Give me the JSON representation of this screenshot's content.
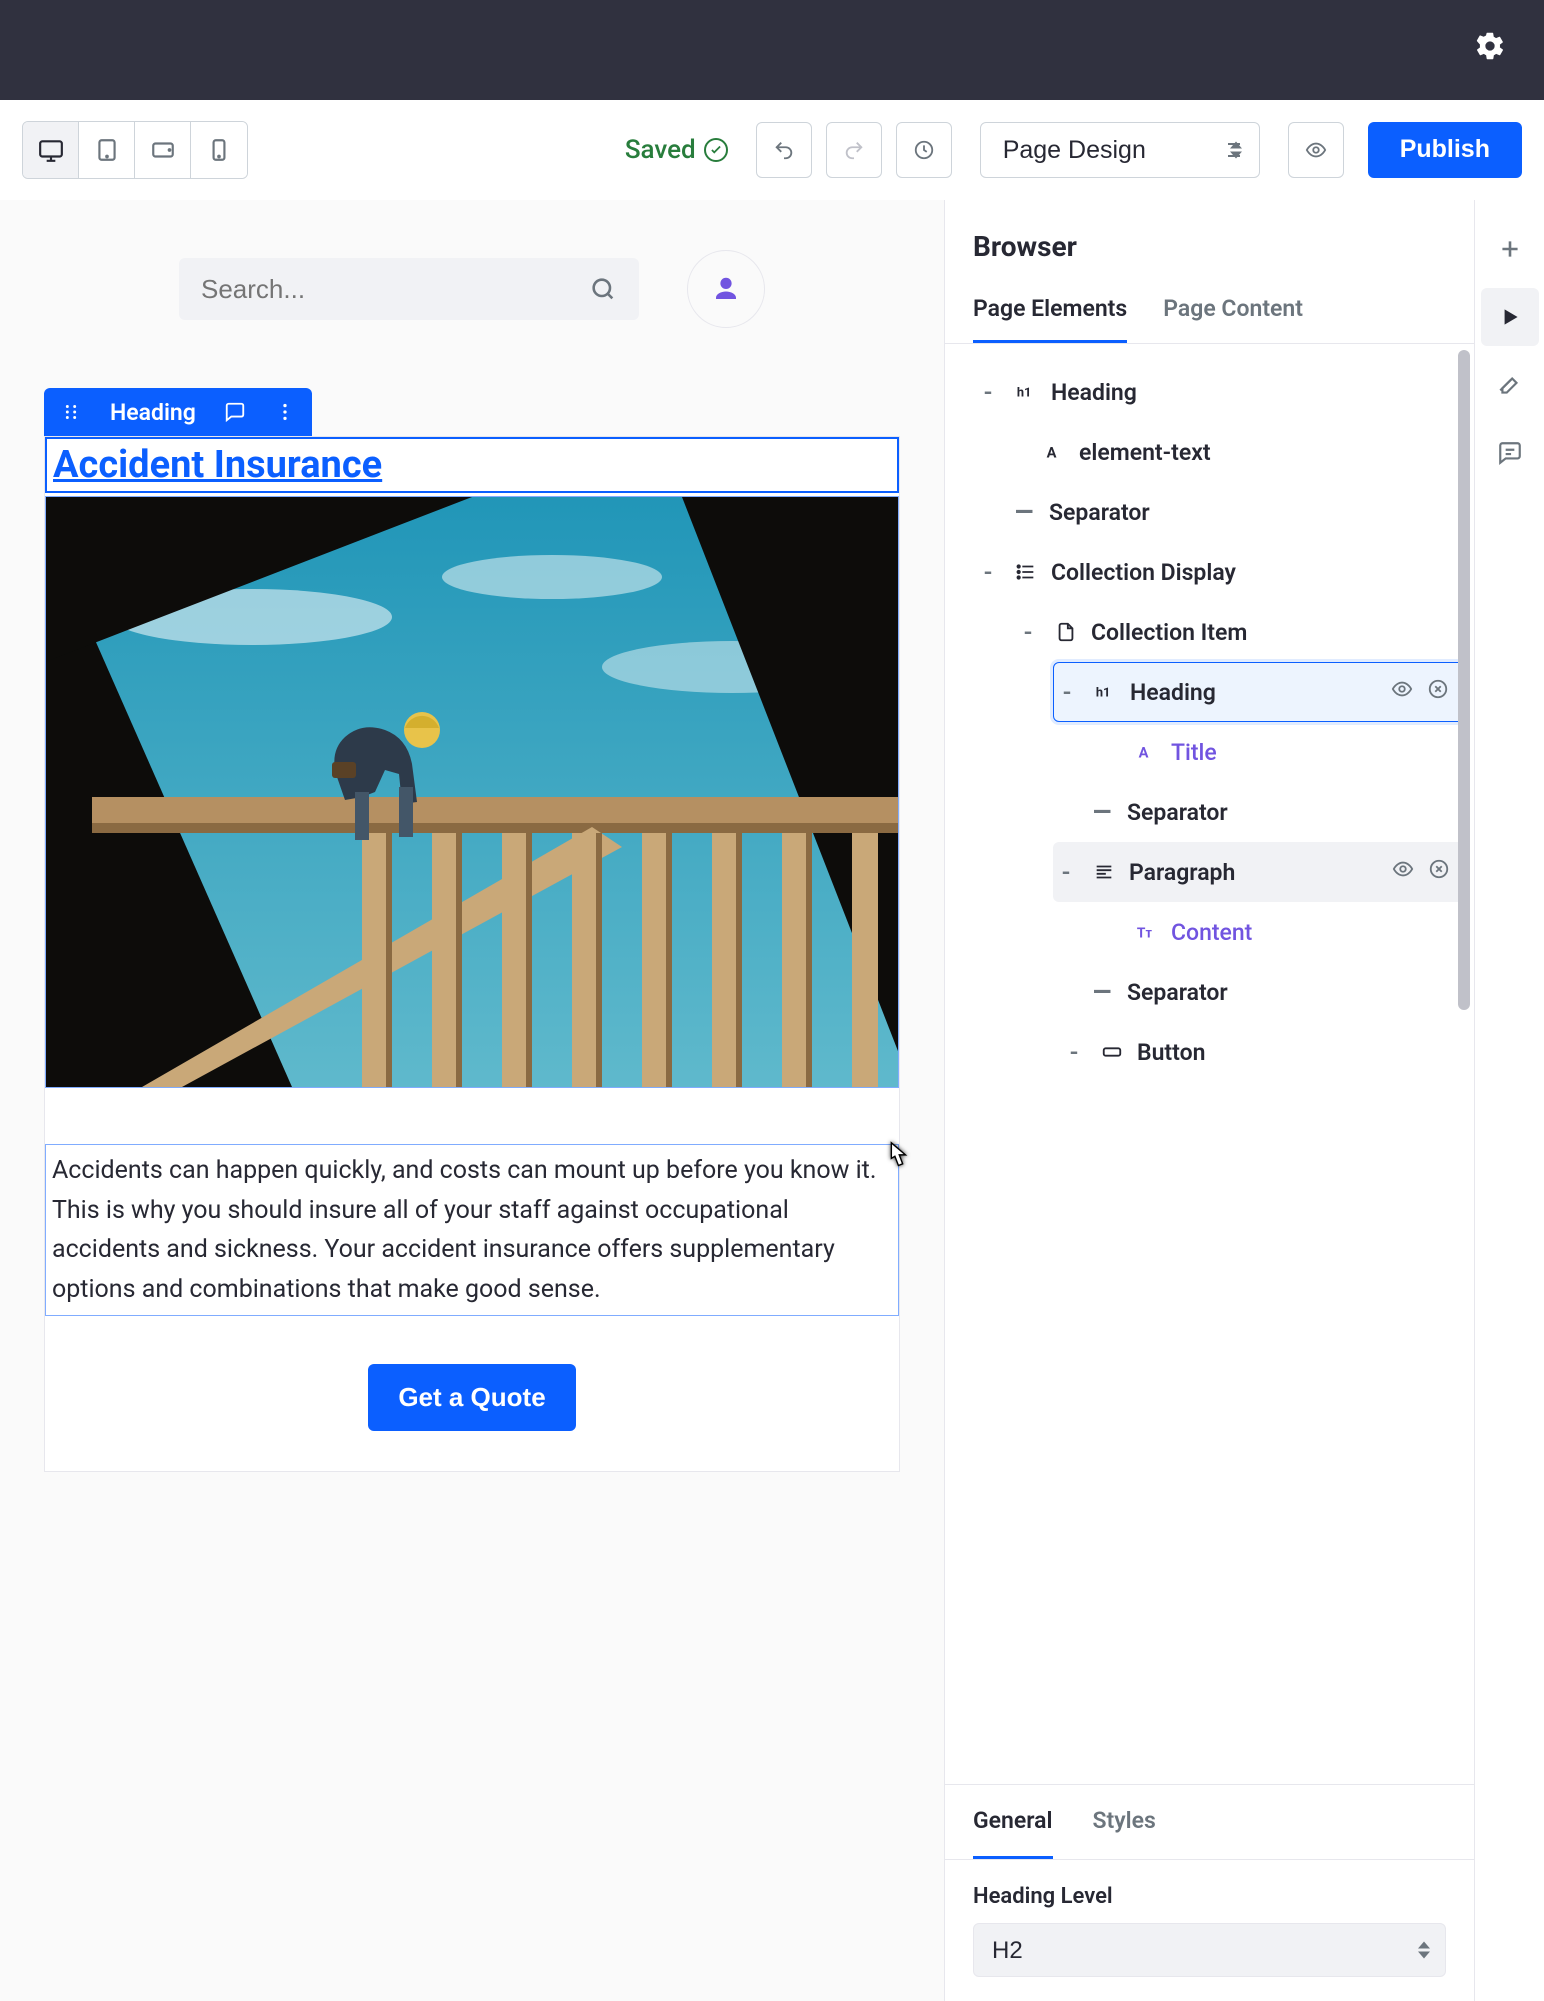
{
  "topbar": {
    "settings_icon": "gear"
  },
  "toolbar": {
    "saved_label": "Saved",
    "page_select": "Page Design",
    "publish_label": "Publish"
  },
  "canvas": {
    "search_placeholder": "Search...",
    "selected_element_label": "Heading",
    "heading_text": "Accident Insurance",
    "paragraph_text": "Accidents can happen quickly, and costs can mount up before you know it. This is why you should insure all of your staff against occupational accidents and sickness. Your accident insurance offers supplementary options and combinations that make good sense.",
    "quote_button": "Get a Quote"
  },
  "browser": {
    "title": "Browser",
    "tabs": {
      "elements": "Page Elements",
      "content": "Page Content"
    },
    "tree": {
      "heading": "Heading",
      "element_text": "element-text",
      "separator": "Separator",
      "collection_display": "Collection Display",
      "collection_item": "Collection Item",
      "heading_sel": "Heading",
      "title_mapped": "Title",
      "separator2": "Separator",
      "paragraph": "Paragraph",
      "content_mapped": "Content",
      "separator3": "Separator",
      "button": "Button"
    }
  },
  "props": {
    "tabs": {
      "general": "General",
      "styles": "Styles"
    },
    "heading_level_label": "Heading Level",
    "heading_level_value": "H2"
  }
}
